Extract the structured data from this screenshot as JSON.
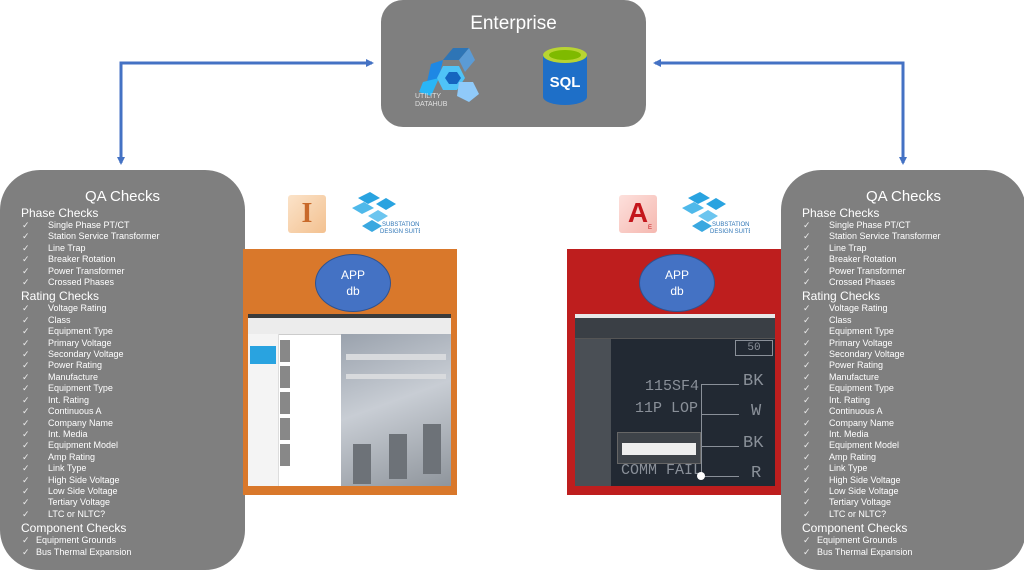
{
  "enterprise": {
    "title": "Enterprise",
    "logos": [
      {
        "name": "utility-datahub",
        "text_line1": "UTILITY",
        "text_line2": "DATAHUB"
      },
      {
        "name": "sql-database",
        "text": "SQL"
      }
    ]
  },
  "qa_panels": {
    "title": "QA Checks",
    "sections": [
      {
        "heading": "Phase Checks",
        "items": [
          "Single Phase PT/CT",
          "Station Service Transformer",
          "Line Trap",
          "Breaker Rotation",
          "Power Transformer",
          "Crossed Phases"
        ]
      },
      {
        "heading": "Rating Checks",
        "items": [
          "Voltage Rating",
          "Class",
          "Equipment Type",
          "Primary Voltage",
          "Secondary Voltage",
          "Power Rating",
          "Manufacture",
          "Equipment Type",
          "Int. Rating",
          "Continuous A",
          "Company Name",
          "Int. Media",
          "Equipment Model",
          "Amp Rating",
          "Link Type",
          "High Side Voltage",
          "Low Side Voltage",
          "Tertiary Voltage",
          "LTC or NLTC?"
        ]
      },
      {
        "heading": "Component Checks",
        "items": [
          "Equipment Grounds",
          "Bus Thermal Expansion"
        ]
      }
    ],
    "check_glyph": "✓"
  },
  "apps": [
    {
      "name": "inventor",
      "icon_letter": "I",
      "suite_text1": "SUBSTATION",
      "suite_text2": "DESIGN SUITE",
      "db_line1": "APP",
      "db_line2": "db",
      "color": "#d9782b"
    },
    {
      "name": "autocad-electrical",
      "icon_letter": "A",
      "icon_sub": "E",
      "suite_text1": "SUBSTATION",
      "suite_text2": "DESIGN SUITE",
      "db_line1": "APP",
      "db_line2": "db",
      "color": "#be1e1e"
    }
  ],
  "cad_labels": {
    "box": "50",
    "l1": "115SF4",
    "l2": "11P LOP",
    "l3": "COMM FAIL",
    "r1": "BK",
    "r2": "W",
    "r3": "BK",
    "r4": "R"
  },
  "colors": {
    "panel": "#7f7f7f",
    "arrow": "#4472c4",
    "orange": "#d9782b",
    "red": "#be1e1e"
  }
}
